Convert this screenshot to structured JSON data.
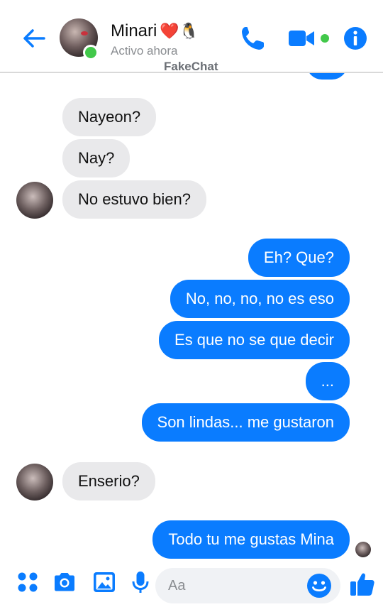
{
  "header": {
    "contact_name": "Minari",
    "name_emojis": "❤️🐧",
    "status": "Activo ahora",
    "watermark": "FakeChat",
    "accent": "#0a7cff",
    "online_color": "#42c84a"
  },
  "messages": [
    {
      "side": "in",
      "text": "Nayeon?"
    },
    {
      "side": "in",
      "text": "Nay?"
    },
    {
      "side": "in",
      "text": "No estuvo bien?"
    },
    {
      "side": "out",
      "text": "Eh? Que?"
    },
    {
      "side": "out",
      "text": "No, no, no, no es eso"
    },
    {
      "side": "out",
      "text": "Es que no se que decir"
    },
    {
      "side": "out",
      "text": "..."
    },
    {
      "side": "out",
      "text": "Son lindas... me gustaron"
    },
    {
      "side": "in",
      "text": "Enserio?"
    },
    {
      "side": "out",
      "text": "Todo tu me gustas Mina"
    }
  ],
  "composer": {
    "placeholder": "Aa",
    "icons": [
      "apps-icon",
      "camera-icon",
      "gallery-icon",
      "mic-icon",
      "emoji-icon",
      "like-icon"
    ]
  }
}
